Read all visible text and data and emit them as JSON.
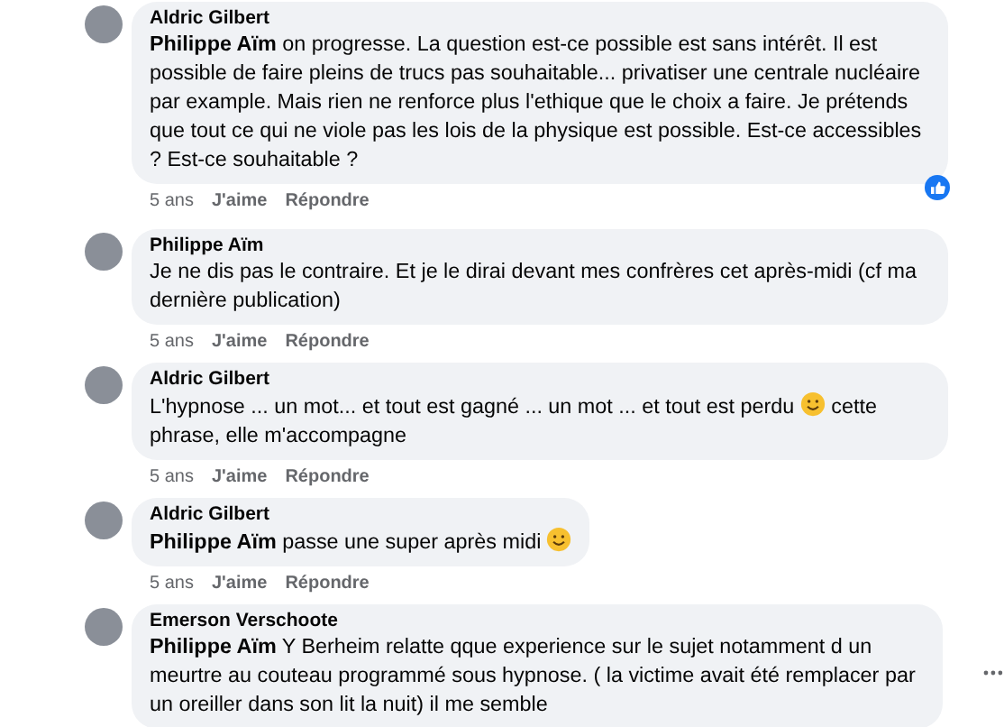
{
  "comments": [
    {
      "author": "Aldric Gilbert",
      "body": [
        {
          "kind": "text",
          "text": "**Philippe Aïm** on progresse. La question est-ce possible est sans intérêt. Il est possible de faire pleins de trucs pas souhaitable... privatiser une centrale nucléaire par example. Mais rien ne renforce plus l'ethique que le choix a faire. Je prétends que tout ce qui ne viole pas les lois de la physique est possible. Est-ce accessibles ? Est-ce souhaitable ?"
        }
      ],
      "time": "5 ans",
      "like": "J'aime",
      "reply": "Répondre",
      "reacted": true,
      "more": false
    },
    {
      "author": "Philippe Aïm",
      "body": [
        {
          "kind": "text",
          "text": "Je ne dis pas le contraire. Et je le dirai devant mes confrères cet après-midi (cf ma dernière publication)"
        }
      ],
      "time": "5 ans",
      "like": "J'aime",
      "reply": "Répondre",
      "reacted": false,
      "more": false
    },
    {
      "author": "Aldric Gilbert",
      "body": [
        {
          "kind": "text",
          "text": "L'hypnose ... un mot... et tout est gagné ... un mot ... et tout est perdu "
        },
        {
          "kind": "emoji"
        },
        {
          "kind": "text",
          "text": " cette phrase, elle m'accompagne"
        }
      ],
      "time": "5 ans",
      "like": "J'aime",
      "reply": "Répondre",
      "reacted": false,
      "more": false
    },
    {
      "author": "Aldric Gilbert",
      "body": [
        {
          "kind": "text",
          "text": "**Philippe Aïm** passe une super après midi "
        },
        {
          "kind": "emoji"
        }
      ],
      "time": "5 ans",
      "like": "J'aime",
      "reply": "Répondre",
      "reacted": false,
      "more": false
    },
    {
      "author": "Emerson Verschoote",
      "body": [
        {
          "kind": "text",
          "text": "**Philippe Aïm** Y Berheim relatte qque experience sur le sujet notamment d un meurtre au couteau programmé sous hypnose. ( la victime avait été remplacer par un oreiller dans son lit la nuit) il me semble"
        }
      ],
      "reacted": false,
      "more": true
    }
  ]
}
